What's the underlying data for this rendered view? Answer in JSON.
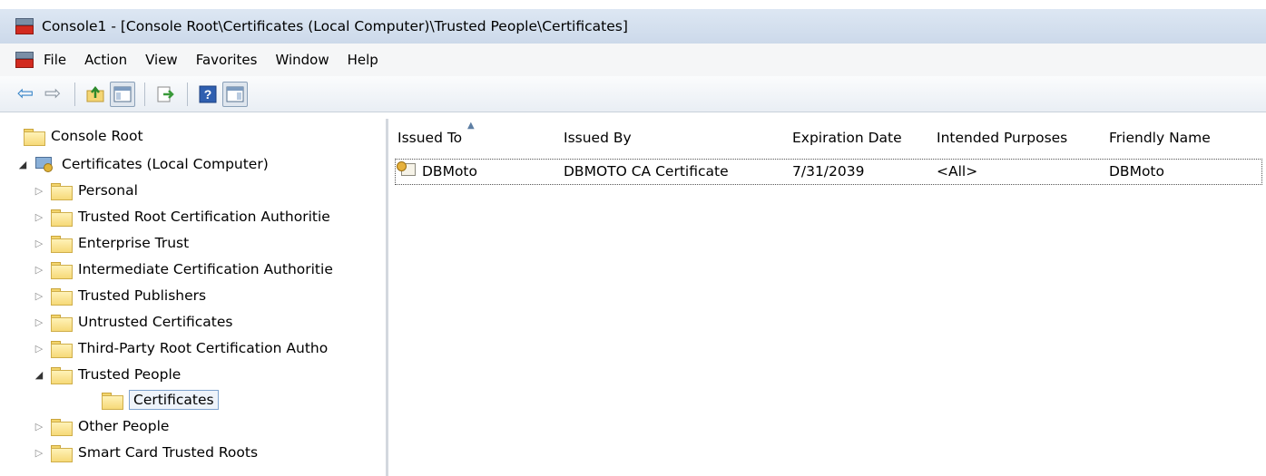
{
  "window": {
    "title": "Console1 - [Console Root\\Certificates (Local Computer)\\Trusted People\\Certificates]"
  },
  "menu": [
    "File",
    "Action",
    "View",
    "Favorites",
    "Window",
    "Help"
  ],
  "toolbar": {
    "buttons": [
      "back-icon",
      "forward-icon",
      "up-folder-icon",
      "show-hide-tree-icon",
      "export-list-icon",
      "help-icon",
      "action-pane-icon"
    ]
  },
  "tree": {
    "root": "Console Root",
    "certificates": "Certificates (Local Computer)",
    "stores": [
      "Personal",
      "Trusted Root Certification Authoritie",
      "Enterprise Trust",
      "Intermediate Certification Authoritie",
      "Trusted Publishers",
      "Untrusted Certificates",
      "Third-Party Root Certification Autho"
    ],
    "trusted_people": "Trusted People",
    "trusted_people_child": "Certificates",
    "stores_after": [
      "Other People",
      "Smart Card Trusted Roots"
    ]
  },
  "list": {
    "columns": [
      "Issued To",
      "Issued By",
      "Expiration Date",
      "Intended Purposes",
      "Friendly Name"
    ],
    "rows": [
      {
        "issued_to": "DBMoto",
        "issued_by": "DBMOTO CA Certificate",
        "expiration": "7/31/2039",
        "purposes": "<All>",
        "friendly": "DBMoto"
      }
    ]
  }
}
